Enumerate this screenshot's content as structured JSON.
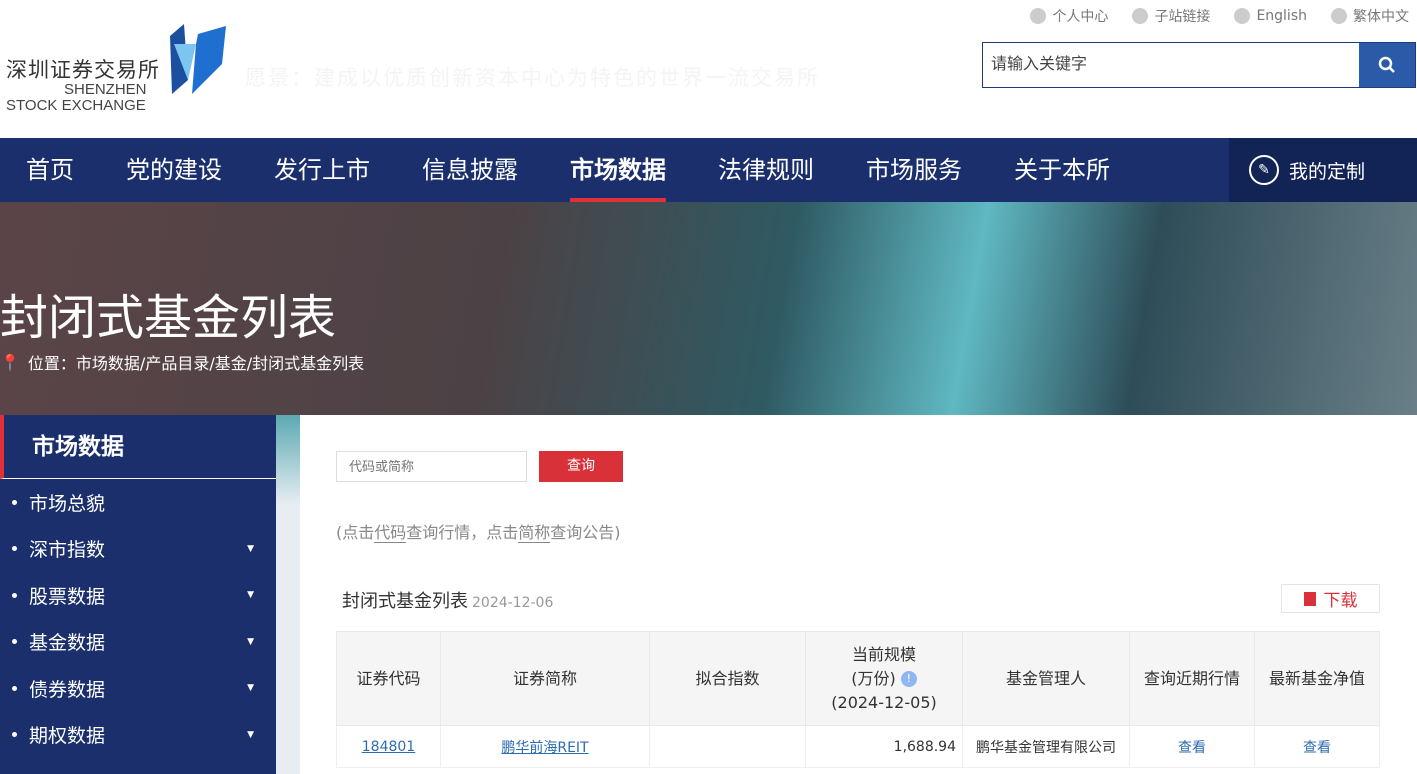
{
  "header": {
    "logo_cn": "深圳证券交易所",
    "logo_en_1": "SHENZHEN",
    "logo_en_2": "STOCK EXCHANGE",
    "vision": "愿景：建成以优质创新资本中心为特色的世界一流交易所",
    "top_links": [
      "个人中心",
      "子站链接",
      "English",
      "繁体中文"
    ],
    "search_placeholder": "请输入关键字"
  },
  "nav": {
    "items": [
      "首页",
      "党的建设",
      "发行上市",
      "信息披露",
      "市场数据",
      "法律规则",
      "市场服务",
      "关于本所"
    ],
    "active": "市场数据",
    "custom": "我的定制"
  },
  "banner": {
    "title": "封闭式基金列表",
    "breadcrumb": "位置：市场数据/产品目录/基金/封闭式基金列表"
  },
  "sidebar": {
    "title": "市场数据",
    "items": [
      {
        "label": "市场总貌"
      },
      {
        "label": "深市指数"
      },
      {
        "label": "股票数据"
      },
      {
        "label": "基金数据"
      },
      {
        "label": "债券数据"
      },
      {
        "label": "期权数据"
      }
    ]
  },
  "query": {
    "placeholder": "代码或简称",
    "button": "查询",
    "hint_1": "(点击",
    "hint_code": "代码",
    "hint_2": "查询行情，点击",
    "hint_name": "简称",
    "hint_3": "查询公告)"
  },
  "list": {
    "title": "封闭式基金列表",
    "date": "2024-12-06",
    "download": "下载",
    "columns": [
      "证券代码",
      "证券简称",
      "拟合指数",
      "当前规模",
      "(万份)",
      "(2024-12-05)",
      "基金管理人",
      "查询近期行情",
      "最新基金净值"
    ],
    "rows": [
      {
        "code": "184801",
        "name": "鹏华前海REIT",
        "index": "",
        "scale": "1,688.94",
        "manager": "鹏华基金管理有限公司",
        "quote": "查看",
        "nav": "查看"
      }
    ]
  },
  "colors": {
    "nav": "#1a2f6b",
    "accent": "#d9313a",
    "link": "#2d6cb5"
  }
}
